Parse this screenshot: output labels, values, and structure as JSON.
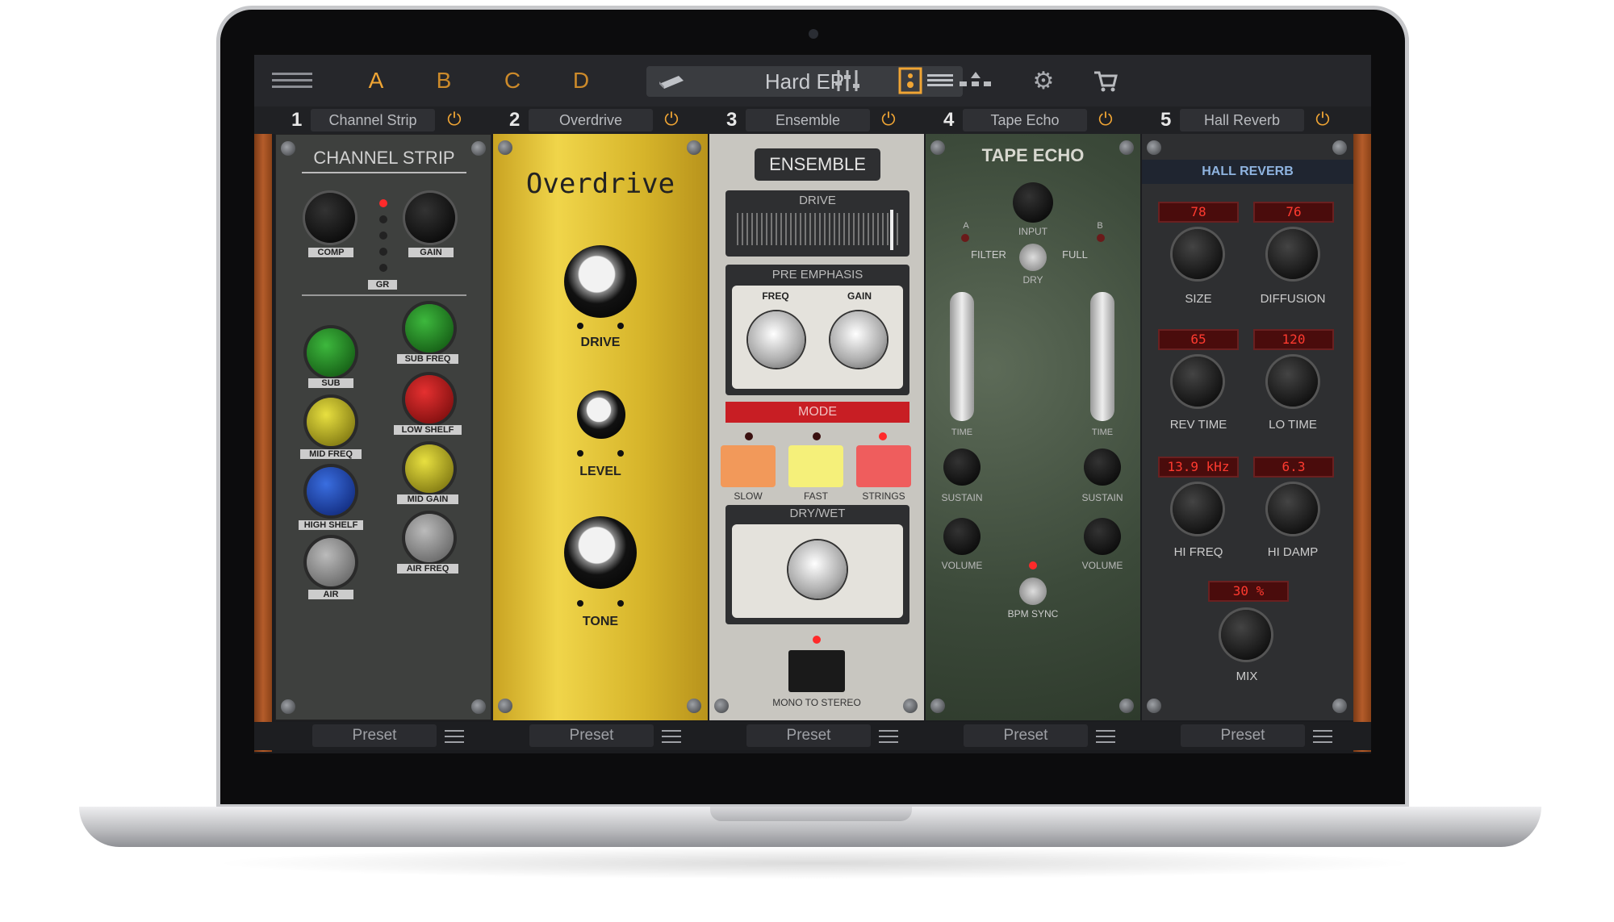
{
  "app": {
    "banks": [
      "A",
      "B",
      "C",
      "D"
    ],
    "active_bank": "A",
    "preset_name": "Hard EP"
  },
  "toolbar_icons": [
    "menu-icon",
    "mixer-icon",
    "amp-icon",
    "signal-chain-icon",
    "gear-icon",
    "cart-icon"
  ],
  "slots": [
    {
      "number": "1",
      "name": "Channel Strip",
      "footer": "Preset"
    },
    {
      "number": "2",
      "name": "Overdrive",
      "footer": "Preset"
    },
    {
      "number": "3",
      "name": "Ensemble",
      "footer": "Preset"
    },
    {
      "number": "4",
      "name": "Tape Echo",
      "footer": "Preset"
    },
    {
      "number": "5",
      "name": "Hall Reverb",
      "footer": "Preset"
    }
  ],
  "channel_strip": {
    "title": "CHANNEL STRIP",
    "labels": {
      "comp": "COMP",
      "gain": "GAIN",
      "gr": "GR",
      "sub": "SUB",
      "sub_freq": "SUB FREQ",
      "low_shelf": "LOW SHELF",
      "mid_freq": "MID FREQ",
      "mid_gain": "MID GAIN",
      "high_shelf": "HIGH SHELF",
      "air_freq": "AIR FREQ",
      "air": "AIR"
    }
  },
  "overdrive": {
    "title": "Overdrive",
    "labels": {
      "drive": "DRIVE",
      "level": "LEVEL",
      "tone": "TONE"
    }
  },
  "ensemble": {
    "title": "ENSEMBLE",
    "labels": {
      "drive": "DRIVE",
      "pre_emphasis": "PRE EMPHASIS",
      "freq": "FREQ",
      "gain": "GAIN",
      "mode": "MODE",
      "slow": "SLOW",
      "fast": "FAST",
      "strings": "STRINGS",
      "dry_wet": "DRY/WET",
      "mono_to_stereo": "MONO TO STEREO"
    }
  },
  "tape_echo": {
    "title": "TAPE ECHO",
    "labels": {
      "a": "A",
      "b": "B",
      "input": "INPUT",
      "filter": "FILTER",
      "full": "FULL",
      "dry": "DRY",
      "time_l": "TIME",
      "time_r": "TIME",
      "sustain_l": "SUSTAIN",
      "sustain_r": "SUSTAIN",
      "volume_l": "VOLUME",
      "volume_r": "VOLUME",
      "bpm_sync": "BPM SYNC"
    }
  },
  "hall_reverb": {
    "title": "HALL REVERB",
    "displays": {
      "size": "78",
      "diffusion": "76",
      "rev_time": "65",
      "lo_time": "120",
      "hi_freq": "13.9 kHz",
      "hi_damp": "6.3",
      "mix": "30 %"
    },
    "labels": {
      "size": "SIZE",
      "diffusion": "DIFFUSION",
      "rev_time": "REV TIME",
      "lo_time": "LO TIME",
      "hi_freq": "HI FREQ",
      "hi_damp": "HI DAMP",
      "mix": "MIX"
    }
  },
  "colors": {
    "accent": "#f0a534",
    "overdrive_panel": "#d8b52a",
    "ensemble_panel": "#c9c7c1",
    "tape_echo_panel": "#4a5a48",
    "reverb_panel": "#2e2f31",
    "mode_slow": "#f2995a",
    "mode_fast": "#f5f07a",
    "mode_strings": "#ef5d5d",
    "lcd_red": "#ff3a2f"
  }
}
